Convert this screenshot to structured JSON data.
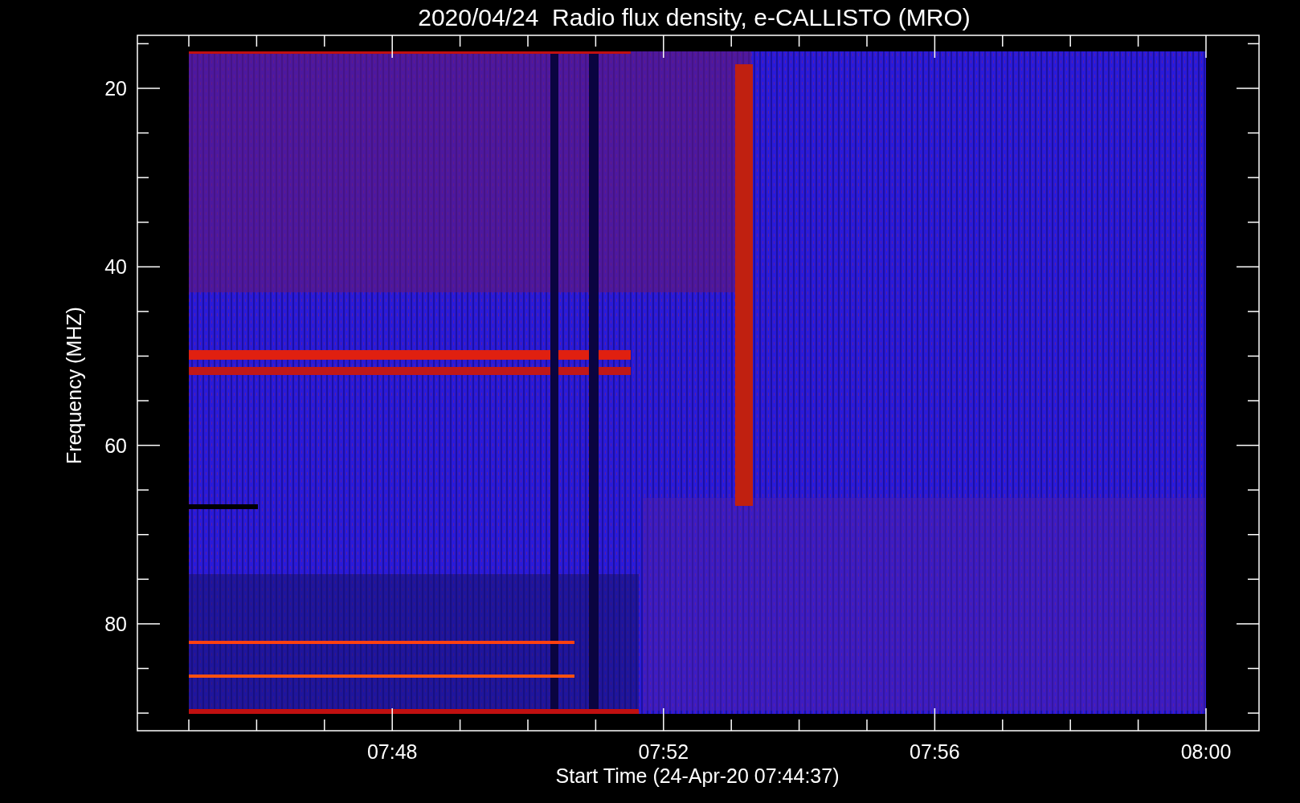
{
  "title": "2020/04/24  Radio flux density, e-CALLISTO (MRO)",
  "y_axis": {
    "label": "Frequency (MHZ)",
    "ticks": [
      "20",
      "40",
      "60",
      "80"
    ]
  },
  "x_axis": {
    "label": "Start Time (24-Apr-20 07:44:37)",
    "ticks": [
      "07:48",
      "07:52",
      "07:56",
      "08:00"
    ]
  }
}
